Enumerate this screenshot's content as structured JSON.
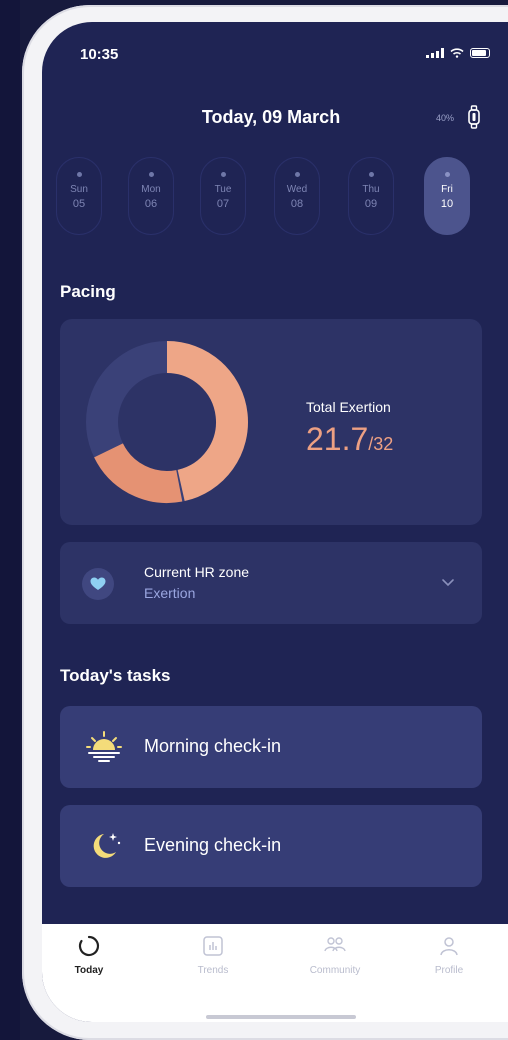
{
  "status_bar": {
    "time": "10:35"
  },
  "header": {
    "title": "Today, 09 March",
    "device_battery": "40%"
  },
  "days": [
    {
      "name": "Sun",
      "num": "05",
      "selected": false
    },
    {
      "name": "Mon",
      "num": "06",
      "selected": false
    },
    {
      "name": "Tue",
      "num": "07",
      "selected": false
    },
    {
      "name": "Wed",
      "num": "08",
      "selected": false
    },
    {
      "name": "Thu",
      "num": "09",
      "selected": false
    },
    {
      "name": "Fri",
      "num": "10",
      "selected": true
    }
  ],
  "pacing": {
    "section_title": "Pacing",
    "total_label": "Total Exertion",
    "total_value": "21.7",
    "total_max": "/32",
    "donut_value": 21.7,
    "donut_max": 32
  },
  "hr": {
    "title": "Current HR zone",
    "zone": "Exertion"
  },
  "tasks": {
    "section_title": "Today's tasks",
    "items": [
      {
        "label": "Morning check-in",
        "icon": "sunrise-icon"
      },
      {
        "label": "Evening check-in",
        "icon": "moon-icon"
      }
    ]
  },
  "tabs": [
    {
      "label": "Today",
      "icon": "today-ring-icon",
      "active": true
    },
    {
      "label": "Trends",
      "icon": "chart-icon",
      "active": false
    },
    {
      "label": "Community",
      "icon": "community-icon",
      "active": false
    },
    {
      "label": "Profile",
      "icon": "profile-icon",
      "active": false
    }
  ],
  "colors": {
    "background": "#1f2454",
    "card": "#2d3366",
    "accent_exertion": "#eda083",
    "donut_track": "#3a4178",
    "selected_day": "#4c548d"
  }
}
